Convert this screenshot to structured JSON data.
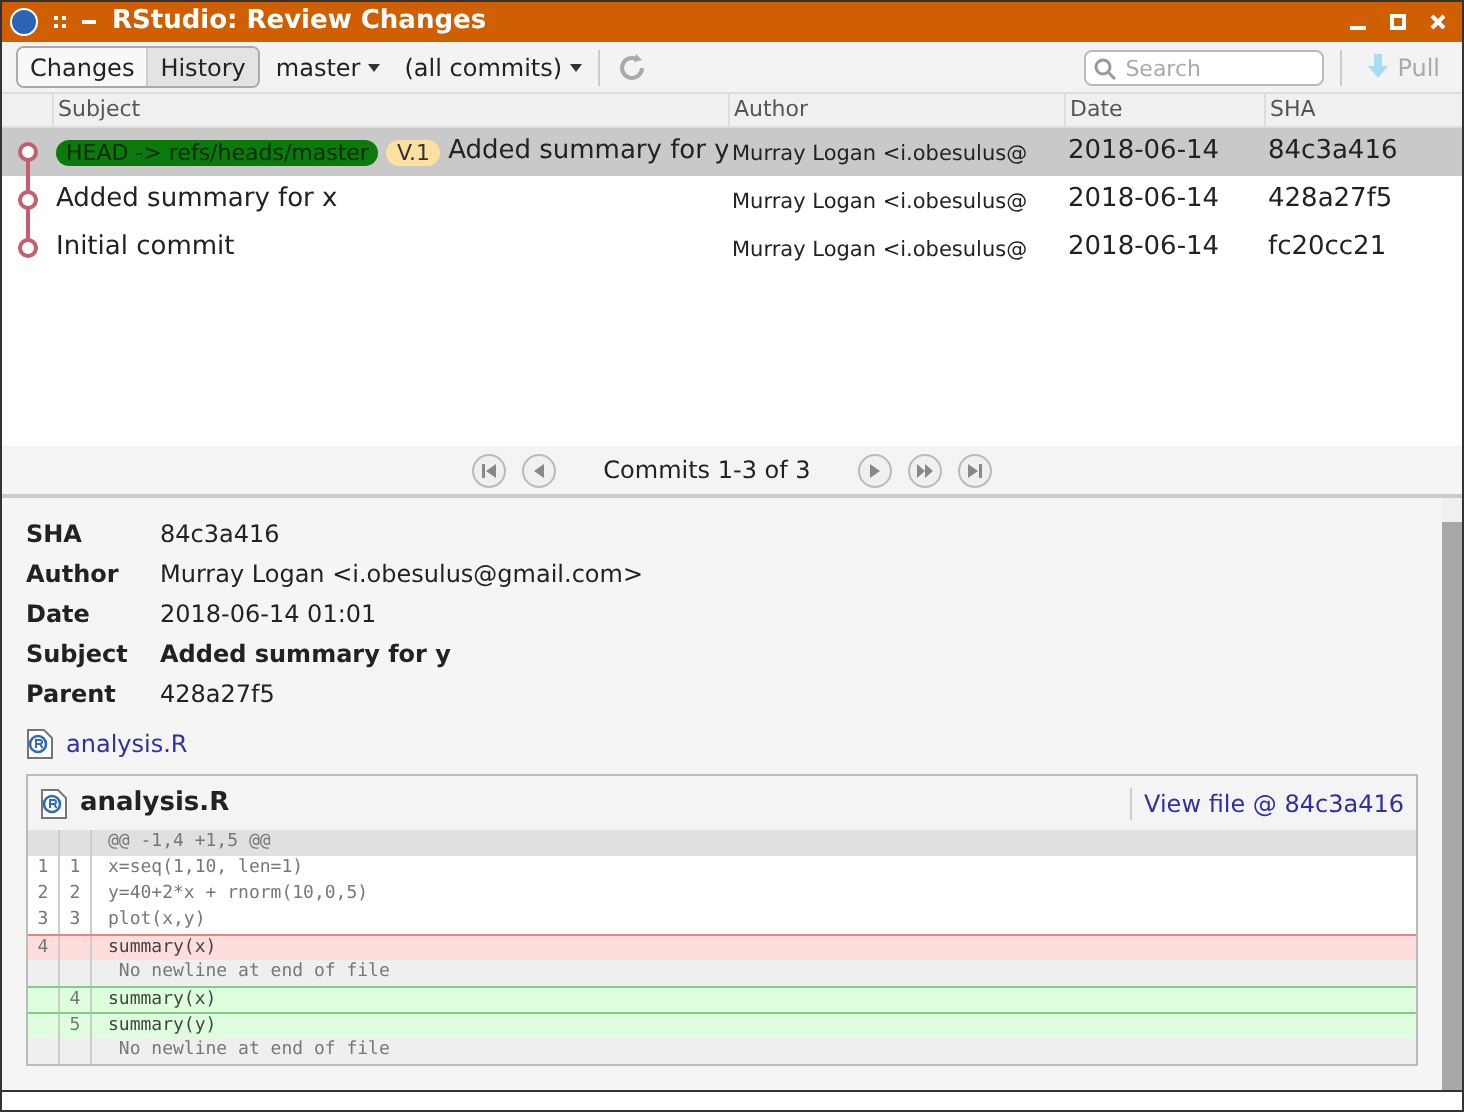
{
  "window": {
    "title": "RStudio: Review Changes"
  },
  "toolbar": {
    "tabs": [
      {
        "label": "Changes",
        "selected": false
      },
      {
        "label": "History",
        "selected": true
      }
    ],
    "branch": "master",
    "filter": "(all commits)",
    "search": {
      "placeholder": "Search"
    },
    "pull": {
      "label": "Pull",
      "disabled": true
    }
  },
  "table": {
    "columns": [
      "Subject",
      "Author",
      "Date",
      "SHA"
    ],
    "rows": [
      {
        "refs": [
          {
            "kind": "head",
            "label": "HEAD -> refs/heads/master"
          },
          {
            "kind": "tag",
            "label": "V.1"
          }
        ],
        "subject": "Added summary for y",
        "author": "Murray Logan <i.obesulus@",
        "date": "2018-06-14",
        "sha": "84c3a416",
        "selected": true
      },
      {
        "refs": [],
        "subject": "Added summary for x",
        "author": "Murray Logan <i.obesulus@",
        "date": "2018-06-14",
        "sha": "428a27f5",
        "selected": false
      },
      {
        "refs": [],
        "subject": "Initial commit",
        "author": "Murray Logan <i.obesulus@",
        "date": "2018-06-14",
        "sha": "fc20cc21",
        "selected": false
      }
    ]
  },
  "pager": {
    "label": "Commits 1-3 of 3"
  },
  "details": {
    "fields": [
      {
        "label": "SHA",
        "value": "84c3a416",
        "bold": false
      },
      {
        "label": "Author",
        "value": "Murray Logan <i.obesulus@gmail.com>",
        "bold": false
      },
      {
        "label": "Date",
        "value": "2018-06-14 01:01",
        "bold": false
      },
      {
        "label": "Subject",
        "value": "Added summary for y",
        "bold": true
      },
      {
        "label": "Parent",
        "value": "428a27f5",
        "bold": false
      }
    ],
    "file_link": "analysis.R",
    "diff": {
      "file": "analysis.R",
      "view_link": "View file @ 84c3a416",
      "lines": [
        {
          "kind": "hunk",
          "text": "@@ -1,4 +1,5 @@"
        },
        {
          "kind": "context",
          "old": "1",
          "new": "1",
          "text": "x=seq(1,10, len=1)"
        },
        {
          "kind": "context",
          "old": "2",
          "new": "2",
          "text": "y=40+2*x + rnorm(10,0,5)"
        },
        {
          "kind": "context",
          "old": "3",
          "new": "3",
          "text": "plot(x,y)"
        },
        {
          "kind": "removed",
          "old": "4",
          "text": "summary(x)"
        },
        {
          "kind": "note",
          "text": " No newline at end of file"
        },
        {
          "kind": "added",
          "new": "4",
          "text": "summary(x)"
        },
        {
          "kind": "added",
          "new": "5",
          "text": "summary(y)"
        },
        {
          "kind": "note",
          "text": " No newline at end of file"
        }
      ]
    }
  }
}
